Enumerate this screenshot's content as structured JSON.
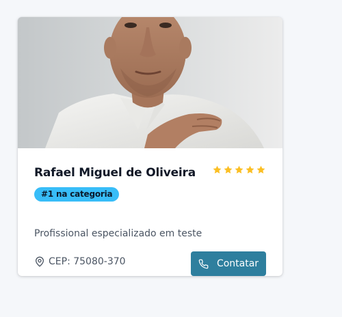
{
  "profile": {
    "name": "Rafael Miguel de Oliveira",
    "rating": 5,
    "rating_max": 5,
    "badge": "#1 na categoria",
    "description": "Profissional especializado em teste",
    "cep": "CEP: 75080-370",
    "contact_label": "Contatar"
  },
  "icons": {
    "star": "star-icon",
    "location": "map-pin-icon",
    "phone": "phone-icon"
  },
  "colors": {
    "star": "#fbbf24",
    "badge_bg": "#38bdf8",
    "button_bg": "#2e7f9e",
    "page_bg": "#f5f7fa"
  }
}
